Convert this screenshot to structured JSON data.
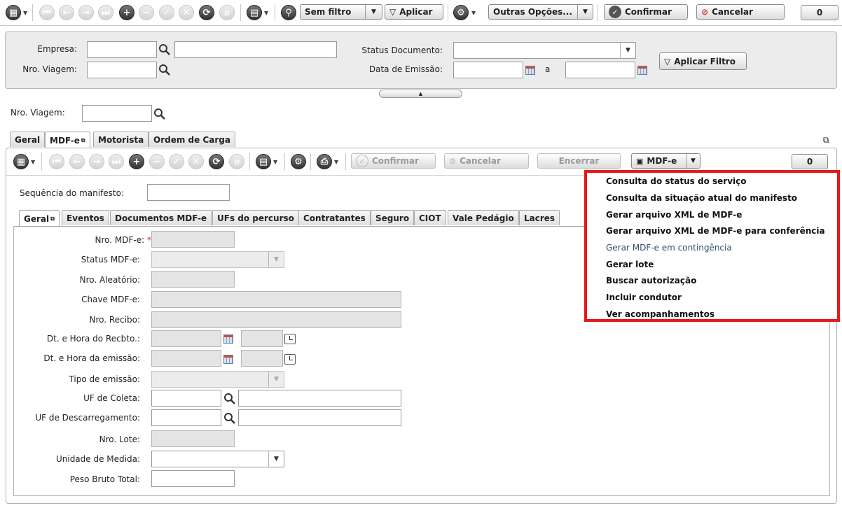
{
  "top_toolbar": {
    "filter_label": "Sem filtro",
    "apply_label": "Aplicar",
    "other_options_label": "Outras Opções...",
    "confirm_label": "Confirmar",
    "cancel_label": "Cancelar",
    "counter": "0"
  },
  "filter_panel": {
    "empresa_label": "Empresa:",
    "viagem_label": "Nro. Viagem:",
    "status_label": "Status Documento:",
    "emissao_label": "Data de Emissão:",
    "a_label": "a",
    "apply_filter_label": "Aplicar Filtro"
  },
  "viagem_field_label": "Nro. Viagem:",
  "main_tabs": [
    {
      "label": "Geral"
    },
    {
      "label": "MDF-e"
    },
    {
      "label": "Motorista"
    },
    {
      "label": "Ordem de Carga"
    }
  ],
  "inner_toolbar": {
    "confirm_label": "Confirmar",
    "cancel_label": "Cancelar",
    "close_label": "Encerrar",
    "mdfe_label": "MDF-e",
    "counter": "0"
  },
  "sequence_label": "Sequência do manifesto:",
  "sub_tabs": [
    {
      "label": "Geral"
    },
    {
      "label": "Eventos"
    },
    {
      "label": "Documentos MDF-e"
    },
    {
      "label": "UFs do percurso"
    },
    {
      "label": "Contratantes"
    },
    {
      "label": "Seguro"
    },
    {
      "label": "CIOT"
    },
    {
      "label": "Vale Pedágio"
    },
    {
      "label": "Lacres"
    }
  ],
  "form": {
    "nro_mdfe": "Nro. MDF-e:",
    "required_mark": "*",
    "status_mdfe": "Status MDF-e:",
    "nro_aleatorio": "Nro. Aleatório:",
    "chave_mdfe": "Chave MDF-e:",
    "nro_recibo": "Nro. Recibo:",
    "dt_recebto": "Dt. e Hora do Recbto.:",
    "dt_emissao": "Dt. e Hora da emissão:",
    "tipo_emissao": "Tipo de emissão:",
    "uf_coleta": "UF de Coleta:",
    "uf_descarregamento": "UF de Descarregamento:",
    "nro_lote": "Nro. Lote:",
    "unidade_medida": "Unidade de Medida:",
    "peso_bruto": "Peso Bruto Total:"
  },
  "dropdown_menu": {
    "items": [
      {
        "label": "Consulta do status do serviço"
      },
      {
        "label": "Consulta da situação atual do manifesto"
      },
      {
        "label": "Gerar arquivo XML de MDF-e"
      },
      {
        "label": "Gerar arquivo XML de MDF-e para conferência"
      },
      {
        "label": "Gerar MDF-e em contingência"
      },
      {
        "label": "Gerar lote"
      },
      {
        "label": "Buscar autorização"
      },
      {
        "label": "Incluir condutor"
      },
      {
        "label": "Ver acompanhamentos"
      }
    ],
    "highlight_color": "#e21b1b"
  }
}
